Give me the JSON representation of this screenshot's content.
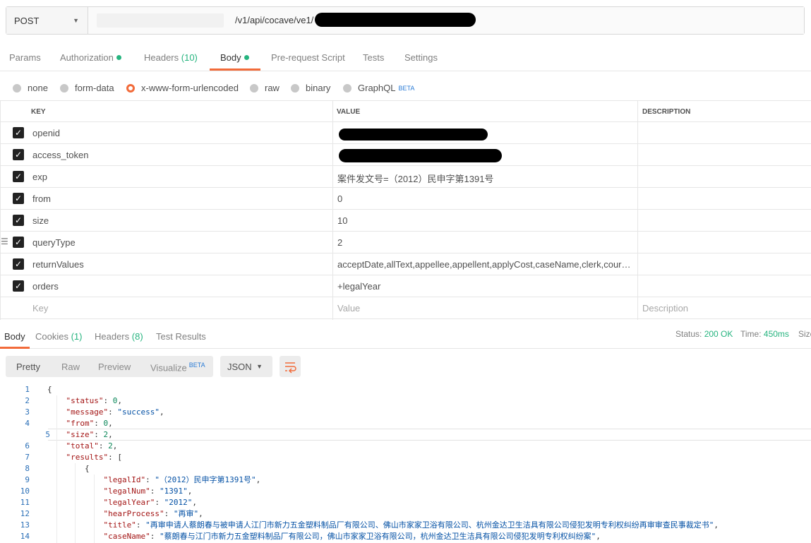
{
  "request": {
    "method": "POST",
    "url_path": "/v1/api/cocave/ve1/"
  },
  "request_tabs": [
    {
      "label": "Params",
      "count": "",
      "dot": false
    },
    {
      "label": "Authorization",
      "count": "",
      "dot": true
    },
    {
      "label": "Headers",
      "count": "(10)",
      "dot": false
    },
    {
      "label": "Body",
      "count": "",
      "dot": true
    },
    {
      "label": "Pre-request Script",
      "count": "",
      "dot": false
    },
    {
      "label": "Tests",
      "count": "",
      "dot": false
    },
    {
      "label": "Settings",
      "count": "",
      "dot": false
    }
  ],
  "active_request_tab": "Body",
  "body_types": [
    {
      "label": "none",
      "selected": false,
      "badge": ""
    },
    {
      "label": "form-data",
      "selected": false,
      "badge": ""
    },
    {
      "label": "x-www-form-urlencoded",
      "selected": true,
      "badge": ""
    },
    {
      "label": "raw",
      "selected": false,
      "badge": ""
    },
    {
      "label": "binary",
      "selected": false,
      "badge": ""
    },
    {
      "label": "GraphQL",
      "selected": false,
      "badge": "BETA"
    }
  ],
  "params_table": {
    "headers": {
      "key": "KEY",
      "value": "VALUE",
      "description": "DESCRIPTION"
    },
    "rows": [
      {
        "key": "openid",
        "value": "",
        "checked": true,
        "redacted": true
      },
      {
        "key": "access_token",
        "value": "",
        "checked": true,
        "redacted": true
      },
      {
        "key": "exp",
        "value": "案件发文号=（2012）民申字第1391号",
        "checked": true
      },
      {
        "key": "from",
        "value": "0",
        "checked": true
      },
      {
        "key": "size",
        "value": "10",
        "checked": true
      },
      {
        "key": "queryType",
        "value": "2",
        "checked": true
      },
      {
        "key": "returnValues",
        "value": "acceptDate,allText,appellee,appellent,applyCost,caseName,clerk,courtCit...",
        "checked": true
      },
      {
        "key": "orders",
        "value": "+legalYear",
        "checked": true
      }
    ],
    "placeholders": {
      "key": "Key",
      "value": "Value",
      "description": "Description"
    }
  },
  "response_tabs": [
    {
      "label": "Body",
      "count": ""
    },
    {
      "label": "Cookies",
      "count": "(1)"
    },
    {
      "label": "Headers",
      "count": "(8)"
    },
    {
      "label": "Test Results",
      "count": ""
    }
  ],
  "response_status": {
    "status_label": "Status:",
    "status_value": "200 OK",
    "time_label": "Time:",
    "time_value": "450ms",
    "size_label": "Size"
  },
  "view_modes": {
    "pretty": "Pretty",
    "raw": "Raw",
    "preview": "Preview",
    "visualize": "Visualize",
    "visualize_badge": "BETA"
  },
  "format_select": "JSON",
  "code_lines": [
    {
      "n": "1",
      "indent": 0,
      "parts": [
        [
          "p",
          "{"
        ]
      ]
    },
    {
      "n": "2",
      "indent": 1,
      "parts": [
        [
          "k",
          "\"status\""
        ],
        [
          "p",
          ": "
        ],
        [
          "n",
          "0"
        ],
        [
          "p",
          ","
        ]
      ]
    },
    {
      "n": "3",
      "indent": 1,
      "parts": [
        [
          "k",
          "\"message\""
        ],
        [
          "p",
          ": "
        ],
        [
          "s",
          "\"success\""
        ],
        [
          "p",
          ","
        ]
      ]
    },
    {
      "n": "4",
      "indent": 1,
      "parts": [
        [
          "k",
          "\"from\""
        ],
        [
          "p",
          ": "
        ],
        [
          "n",
          "0"
        ],
        [
          "p",
          ","
        ]
      ]
    },
    {
      "n": "5",
      "indent": 1,
      "parts": [
        [
          "k",
          "\"size\""
        ],
        [
          "p",
          ": "
        ],
        [
          "n",
          "2"
        ],
        [
          "p",
          ","
        ]
      ]
    },
    {
      "n": "6",
      "indent": 1,
      "parts": [
        [
          "k",
          "\"total\""
        ],
        [
          "p",
          ": "
        ],
        [
          "n",
          "2"
        ],
        [
          "p",
          ","
        ]
      ]
    },
    {
      "n": "7",
      "indent": 1,
      "parts": [
        [
          "k",
          "\"results\""
        ],
        [
          "p",
          ": ["
        ]
      ]
    },
    {
      "n": "8",
      "indent": 2,
      "parts": [
        [
          "p",
          "{"
        ]
      ]
    },
    {
      "n": "9",
      "indent": 3,
      "parts": [
        [
          "k",
          "\"legalId\""
        ],
        [
          "p",
          ": "
        ],
        [
          "s",
          "\"（2012）民申字第1391号\""
        ],
        [
          "p",
          ","
        ]
      ]
    },
    {
      "n": "10",
      "indent": 3,
      "parts": [
        [
          "k",
          "\"legalNum\""
        ],
        [
          "p",
          ": "
        ],
        [
          "s",
          "\"1391\""
        ],
        [
          "p",
          ","
        ]
      ]
    },
    {
      "n": "11",
      "indent": 3,
      "parts": [
        [
          "k",
          "\"legalYear\""
        ],
        [
          "p",
          ": "
        ],
        [
          "s",
          "\"2012\""
        ],
        [
          "p",
          ","
        ]
      ]
    },
    {
      "n": "12",
      "indent": 3,
      "parts": [
        [
          "k",
          "\"hearProcess\""
        ],
        [
          "p",
          ": "
        ],
        [
          "s",
          "\"再审\""
        ],
        [
          "p",
          ","
        ]
      ]
    },
    {
      "n": "13",
      "indent": 3,
      "parts": [
        [
          "k",
          "\"title\""
        ],
        [
          "p",
          ": "
        ],
        [
          "s",
          "\"再审申请人蔡朗春与被申请人江门市新力五金塑料制品厂有限公司、佛山市家家卫浴有限公司、杭州金达卫生洁具有限公司侵犯发明专利权纠纷再审审查民事裁定书\""
        ],
        [
          "p",
          ","
        ]
      ]
    },
    {
      "n": "14",
      "indent": 3,
      "parts": [
        [
          "k",
          "\"caseName\""
        ],
        [
          "p",
          ": "
        ],
        [
          "s",
          "\"蔡朗春与江门市新力五金塑料制品厂有限公司，佛山市家家卫浴有限公司，杭州金达卫生洁具有限公司侵犯发明专利权纠纷案\""
        ],
        [
          "p",
          ","
        ]
      ]
    }
  ]
}
